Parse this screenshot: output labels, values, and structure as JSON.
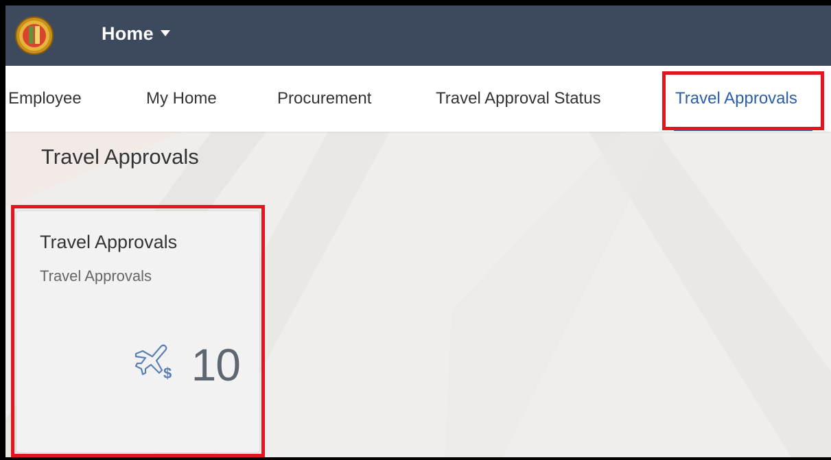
{
  "shell": {
    "title": "Home",
    "header_color": "#3d4a5e",
    "logo_icon": "city-seal-icon"
  },
  "tabs": [
    {
      "label": "Employee",
      "active": false
    },
    {
      "label": "My Home",
      "active": false
    },
    {
      "label": "Procurement",
      "active": false
    },
    {
      "label": "Travel Approval Status",
      "active": false
    },
    {
      "label": "Travel Approvals",
      "active": true
    }
  ],
  "section": {
    "title": "Travel Approvals"
  },
  "tile": {
    "title": "Travel Approvals",
    "subtitle": "Travel Approvals",
    "icon": "airplane-dollar-icon",
    "count": "10"
  },
  "colors": {
    "accent": "#2b5ea7",
    "highlight": "#e3161f",
    "background": "#efeeec"
  }
}
